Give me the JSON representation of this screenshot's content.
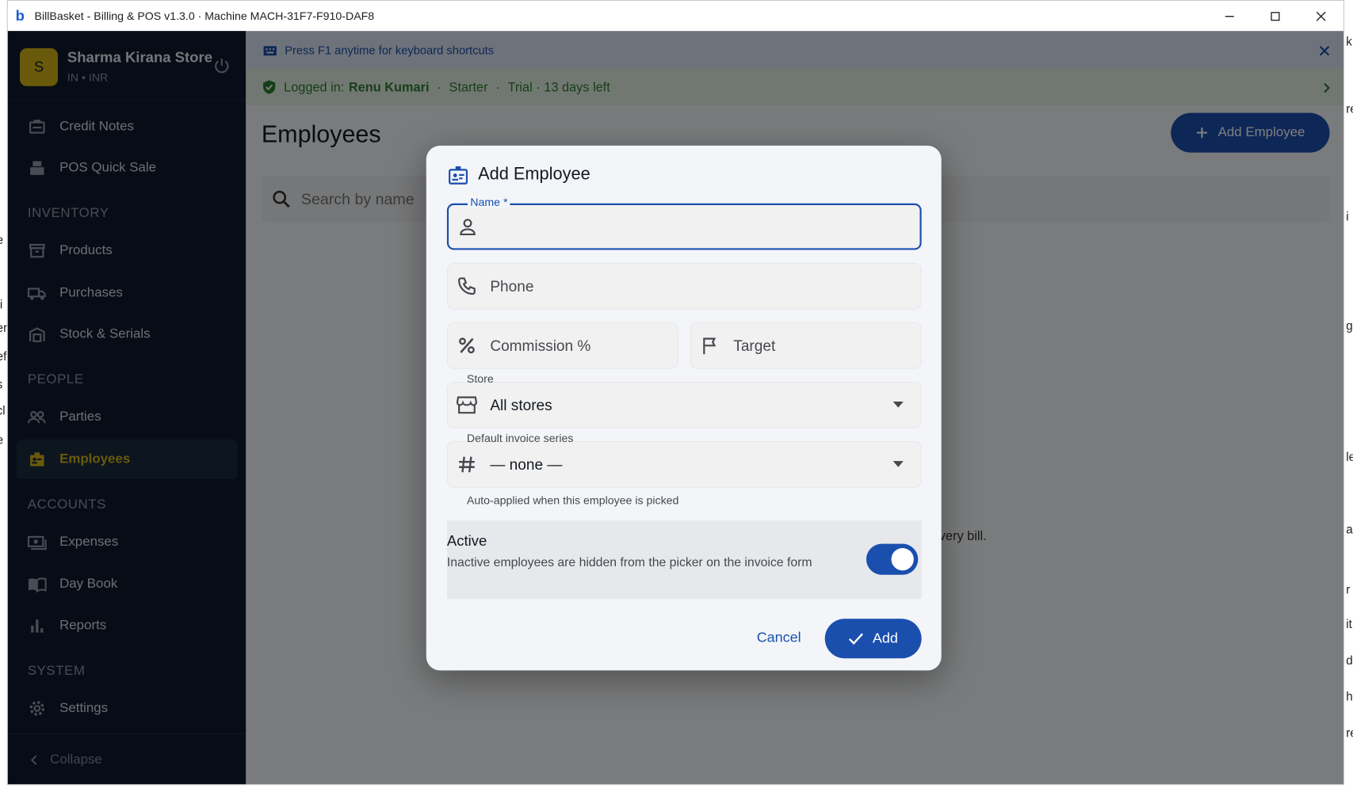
{
  "window": {
    "title": "BillBasket - Billing & POS  v1.3.0  ·  Machine MACH-31F7-F910-DAF8",
    "logo_letter": "b"
  },
  "sidebar": {
    "store_initial": "S",
    "store_name": "Sharma Kirana Store",
    "store_sub": "IN • INR",
    "items": [
      {
        "label": "Credit Notes",
        "icon": "credit-note-icon"
      },
      {
        "label": "POS Quick Sale",
        "icon": "pos-icon"
      },
      {
        "label": "Products",
        "icon": "products-icon"
      },
      {
        "label": "Purchases",
        "icon": "truck-icon"
      },
      {
        "label": "Stock & Serials",
        "icon": "warehouse-icon"
      },
      {
        "label": "Parties",
        "icon": "people-icon"
      },
      {
        "label": "Employees",
        "icon": "employee-badge-icon"
      },
      {
        "label": "Expenses",
        "icon": "cash-icon"
      },
      {
        "label": "Day Book",
        "icon": "book-icon"
      },
      {
        "label": "Reports",
        "icon": "bar-chart-icon"
      },
      {
        "label": "Settings",
        "icon": "gear-icon"
      }
    ],
    "sections": [
      "INVENTORY",
      "PEOPLE",
      "ACCOUNTS",
      "SYSTEM"
    ],
    "collapse_label": "Collapse"
  },
  "banners": {
    "shortcut_text": "Press F1 anytime for keyboard shortcuts",
    "logged_in_label": "Logged in:",
    "user_name": "Renu Kumari",
    "plan": "Starter",
    "trial": "Trial · 13 days left"
  },
  "page": {
    "title": "Employees",
    "add_button": "Add Employee",
    "search_placeholder": "Search by name",
    "empty_hint_tail": "every bill."
  },
  "dialog": {
    "title": "Add Employee",
    "name_label": "Name *",
    "name_value": "",
    "phone_placeholder": "Phone",
    "commission_placeholder": "Commission %",
    "target_placeholder": "Target",
    "store_label": "Store",
    "store_value": "All stores",
    "series_label": "Default invoice series",
    "series_value": "— none —",
    "series_helper": "Auto-applied when this employee is picked",
    "active_title": "Active",
    "active_desc": "Inactive employees are hidden from the picker on the invoice form",
    "active_on": true,
    "cancel_label": "Cancel",
    "add_label": "Add"
  },
  "colors": {
    "primary": "#1a4fae",
    "sidebar_bg": "#0f1b2d",
    "accent_gold": "#d3b417",
    "success": "#2e7d32"
  }
}
